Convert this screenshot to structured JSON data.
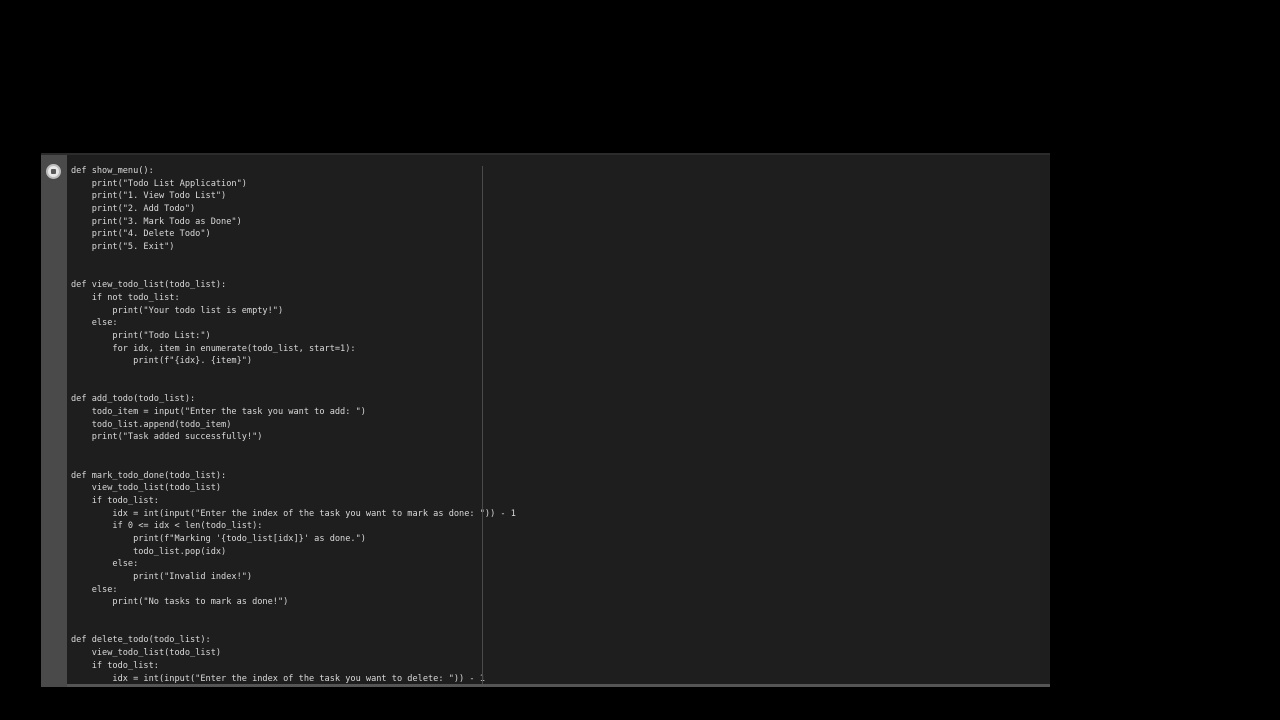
{
  "notebook": {
    "run_button_icon": "stop-circle-icon",
    "code_lines": [
      "def show_menu():",
      "    print(\"Todo List Application\")",
      "    print(\"1. View Todo List\")",
      "    print(\"2. Add Todo\")",
      "    print(\"3. Mark Todo as Done\")",
      "    print(\"4. Delete Todo\")",
      "    print(\"5. Exit\")",
      "",
      "",
      "def view_todo_list(todo_list):",
      "    if not todo_list:",
      "        print(\"Your todo list is empty!\")",
      "    else:",
      "        print(\"Todo List:\")",
      "        for idx, item in enumerate(todo_list, start=1):",
      "            print(f\"{idx}. {item}\")",
      "",
      "",
      "def add_todo(todo_list):",
      "    todo_item = input(\"Enter the task you want to add: \")",
      "    todo_list.append(todo_item)",
      "    print(\"Task added successfully!\")",
      "",
      "",
      "def mark_todo_done(todo_list):",
      "    view_todo_list(todo_list)",
      "    if todo_list:",
      "        idx = int(input(\"Enter the index of the task you want to mark as done: \")) - 1",
      "        if 0 <= idx < len(todo_list):",
      "            print(f\"Marking '{todo_list[idx]}' as done.\")",
      "            todo_list.pop(idx)",
      "        else:",
      "            print(\"Invalid index!\")",
      "    else:",
      "        print(\"No tasks to mark as done!\")",
      "",
      "",
      "def delete_todo(todo_list):",
      "    view_todo_list(todo_list)",
      "    if todo_list:",
      "        idx = int(input(\"Enter the index of the task you want to delete: \")) - 1"
    ]
  }
}
